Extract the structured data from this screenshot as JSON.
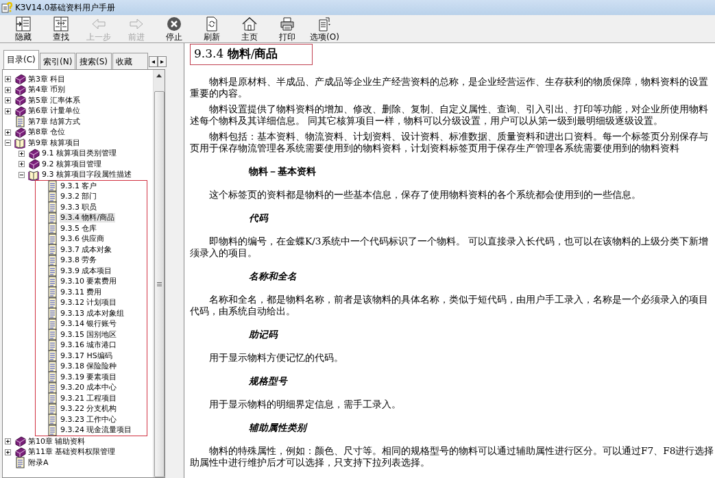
{
  "window": {
    "title": "K3V14.0基础资料用户手册"
  },
  "toolbar": [
    {
      "label": "隐藏",
      "disabled": false
    },
    {
      "label": "查找",
      "disabled": false
    },
    {
      "label": "上一步",
      "disabled": true
    },
    {
      "label": "前进",
      "disabled": true
    },
    {
      "label": "停止",
      "disabled": false
    },
    {
      "label": "刷新",
      "disabled": false
    },
    {
      "label": "主页",
      "disabled": false
    },
    {
      "label": "打印",
      "disabled": false
    },
    {
      "label": "选项(O)",
      "disabled": false
    }
  ],
  "tabs": [
    {
      "label": "目录(C)",
      "selected": true
    },
    {
      "label": "索引(N)",
      "selected": false
    },
    {
      "label": "搜索(S)",
      "selected": false
    },
    {
      "label": "收藏",
      "selected": false
    }
  ],
  "tab_scroll": [
    "◂",
    "▸"
  ],
  "tree": [
    {
      "label": "第3章 科目",
      "kind": "book",
      "expanded": false,
      "selected": false
    },
    {
      "label": "第4章 币别",
      "kind": "book",
      "expanded": false,
      "selected": false
    },
    {
      "label": "第5章 汇率体系",
      "kind": "book",
      "expanded": false,
      "selected": false
    },
    {
      "label": "第6章 计量单位",
      "kind": "book",
      "expanded": false,
      "selected": false
    },
    {
      "label": "第7章 结算方式",
      "kind": "page",
      "selected": false
    },
    {
      "label": "第8章 仓位",
      "kind": "book",
      "expanded": false,
      "selected": false
    },
    {
      "label": "第9章 核算项目",
      "kind": "book",
      "expanded": true,
      "selected": false,
      "children": [
        {
          "label": "9.1 核算项目类别管理",
          "kind": "book",
          "expanded": false,
          "selected": false
        },
        {
          "label": "9.2 核算项目管理",
          "kind": "book",
          "expanded": false,
          "selected": false
        },
        {
          "label": "9.3 核算项目字段属性描述",
          "kind": "book",
          "expanded": true,
          "selected": false,
          "children_boxed": true,
          "children": [
            {
              "label": "9.3.1 客户",
              "kind": "page",
              "selected": false
            },
            {
              "label": "9.3.2 部门",
              "kind": "page",
              "selected": false
            },
            {
              "label": "9.3.3 职员",
              "kind": "page",
              "selected": false
            },
            {
              "label": "9.3.4 物料/商品",
              "kind": "page",
              "selected": true
            },
            {
              "label": "9.3.5 仓库",
              "kind": "page",
              "selected": false
            },
            {
              "label": "9.3.6 供应商",
              "kind": "page",
              "selected": false
            },
            {
              "label": "9.3.7 成本对象",
              "kind": "page",
              "selected": false
            },
            {
              "label": "9.3.8 劳务",
              "kind": "page",
              "selected": false
            },
            {
              "label": "9.3.9 成本项目",
              "kind": "page",
              "selected": false
            },
            {
              "label": "9.3.10 要素费用",
              "kind": "page",
              "selected": false
            },
            {
              "label": "9.3.11 费用",
              "kind": "page",
              "selected": false
            },
            {
              "label": "9.3.12 计划项目",
              "kind": "page",
              "selected": false
            },
            {
              "label": "9.3.13 成本对象组",
              "kind": "page",
              "selected": false
            },
            {
              "label": "9.3.14 银行账号",
              "kind": "page",
              "selected": false
            },
            {
              "label": "9.3.15 国别地区",
              "kind": "page",
              "selected": false
            },
            {
              "label": "9.3.16 城市港口",
              "kind": "page",
              "selected": false
            },
            {
              "label": "9.3.17 HS编码",
              "kind": "page",
              "selected": false
            },
            {
              "label": "9.3.18 保险险种",
              "kind": "page",
              "selected": false
            },
            {
              "label": "9.3.19 要素项目",
              "kind": "page",
              "selected": false
            },
            {
              "label": "9.3.20 成本中心",
              "kind": "page",
              "selected": false
            },
            {
              "label": "9.3.21 工程项目",
              "kind": "page",
              "selected": false
            },
            {
              "label": "9.3.22 分支机构",
              "kind": "page",
              "selected": false
            },
            {
              "label": "9.3.23 工作中心",
              "kind": "page",
              "selected": false
            },
            {
              "label": "9.3.24 现金流量项目",
              "kind": "page",
              "selected": false
            }
          ]
        }
      ]
    },
    {
      "label": "第10章 辅助资料",
      "kind": "book",
      "expanded": false,
      "selected": false
    },
    {
      "label": "第11章 基础资料权限管理",
      "kind": "book",
      "expanded": false,
      "selected": false
    },
    {
      "label": "附录A",
      "kind": "page",
      "selected": false
    }
  ],
  "article": {
    "title": "9.3.4 **物料**/**商品**",
    "title_boxed": true,
    "blocks": [
      {
        "kind": "para",
        "lines": [
          "物料是原材料、半成品、产成品等企业生产经营资料的总称，是企业经营运作、生存获利的物质保障，物料资料的设置",
          "重要的内容。"
        ]
      },
      {
        "kind": "para",
        "lines": [
          "物料设置提供了物料资料的增加、修改、删除、复制、自定义属性、查询、引入引出、打印等功能，对企业所使用物料",
          "述每个物料及其详细信息。 同其它核算项目一样，物料可以分级设置，用户可以从第一级到最明细级逐级设置。"
        ]
      },
      {
        "kind": "para",
        "lines": [
          "物料包括：基本资料、物流资料、计划资料、设计资料、标准数据、质量资料和进出口资料。每一个标签页分别保存与",
          "页用于保存物流管理各系统需要使用到的物料资料，计划资料标签页用于保存生产管理各系统需要使用到的物料资料"
        ]
      },
      {
        "kind": "heading",
        "text": "物料－基本资料"
      },
      {
        "kind": "para",
        "lines": [
          "这个标签页的资料都是物料的一些基本信息，保存了使用物料资料的各个系统都会使用到的一些信息。"
        ]
      },
      {
        "kind": "subheading",
        "text": "代码"
      },
      {
        "kind": "para",
        "lines": [
          "即物料的编号，在金蝶K/3系统中一个代码标识了一个物料。 可以直接录入长代码，也可以在该物料的上级分类下新增",
          "须录入的项目。"
        ]
      },
      {
        "kind": "subheading",
        "text": "名称和全名"
      },
      {
        "kind": "para",
        "lines": [
          "名称和全名，都是物料名称，前者是该物料的具体名称，类似于短代码，由用户手工录入，名称是一个必须录入的项目",
          "代码，由系统自动给出。"
        ]
      },
      {
        "kind": "subheading",
        "text": "助记码"
      },
      {
        "kind": "para",
        "lines": [
          "用于显示物料方便记忆的代码。"
        ]
      },
      {
        "kind": "subheading",
        "text": "规格型号"
      },
      {
        "kind": "para",
        "lines": [
          "用于显示物料的明细界定信息，需手工录入。"
        ]
      },
      {
        "kind": "subheading",
        "text": "辅助属性类别"
      },
      {
        "kind": "para",
        "lines": [
          "物料的特殊属性，例如：颜色、尺寸等。相同的规格型号的物料可以通过辅助属性进行区分。可以通过F7、F8进行选择",
          "助属性中进行维护后才可以选择，只支持下拉列表选择。"
        ]
      }
    ]
  }
}
